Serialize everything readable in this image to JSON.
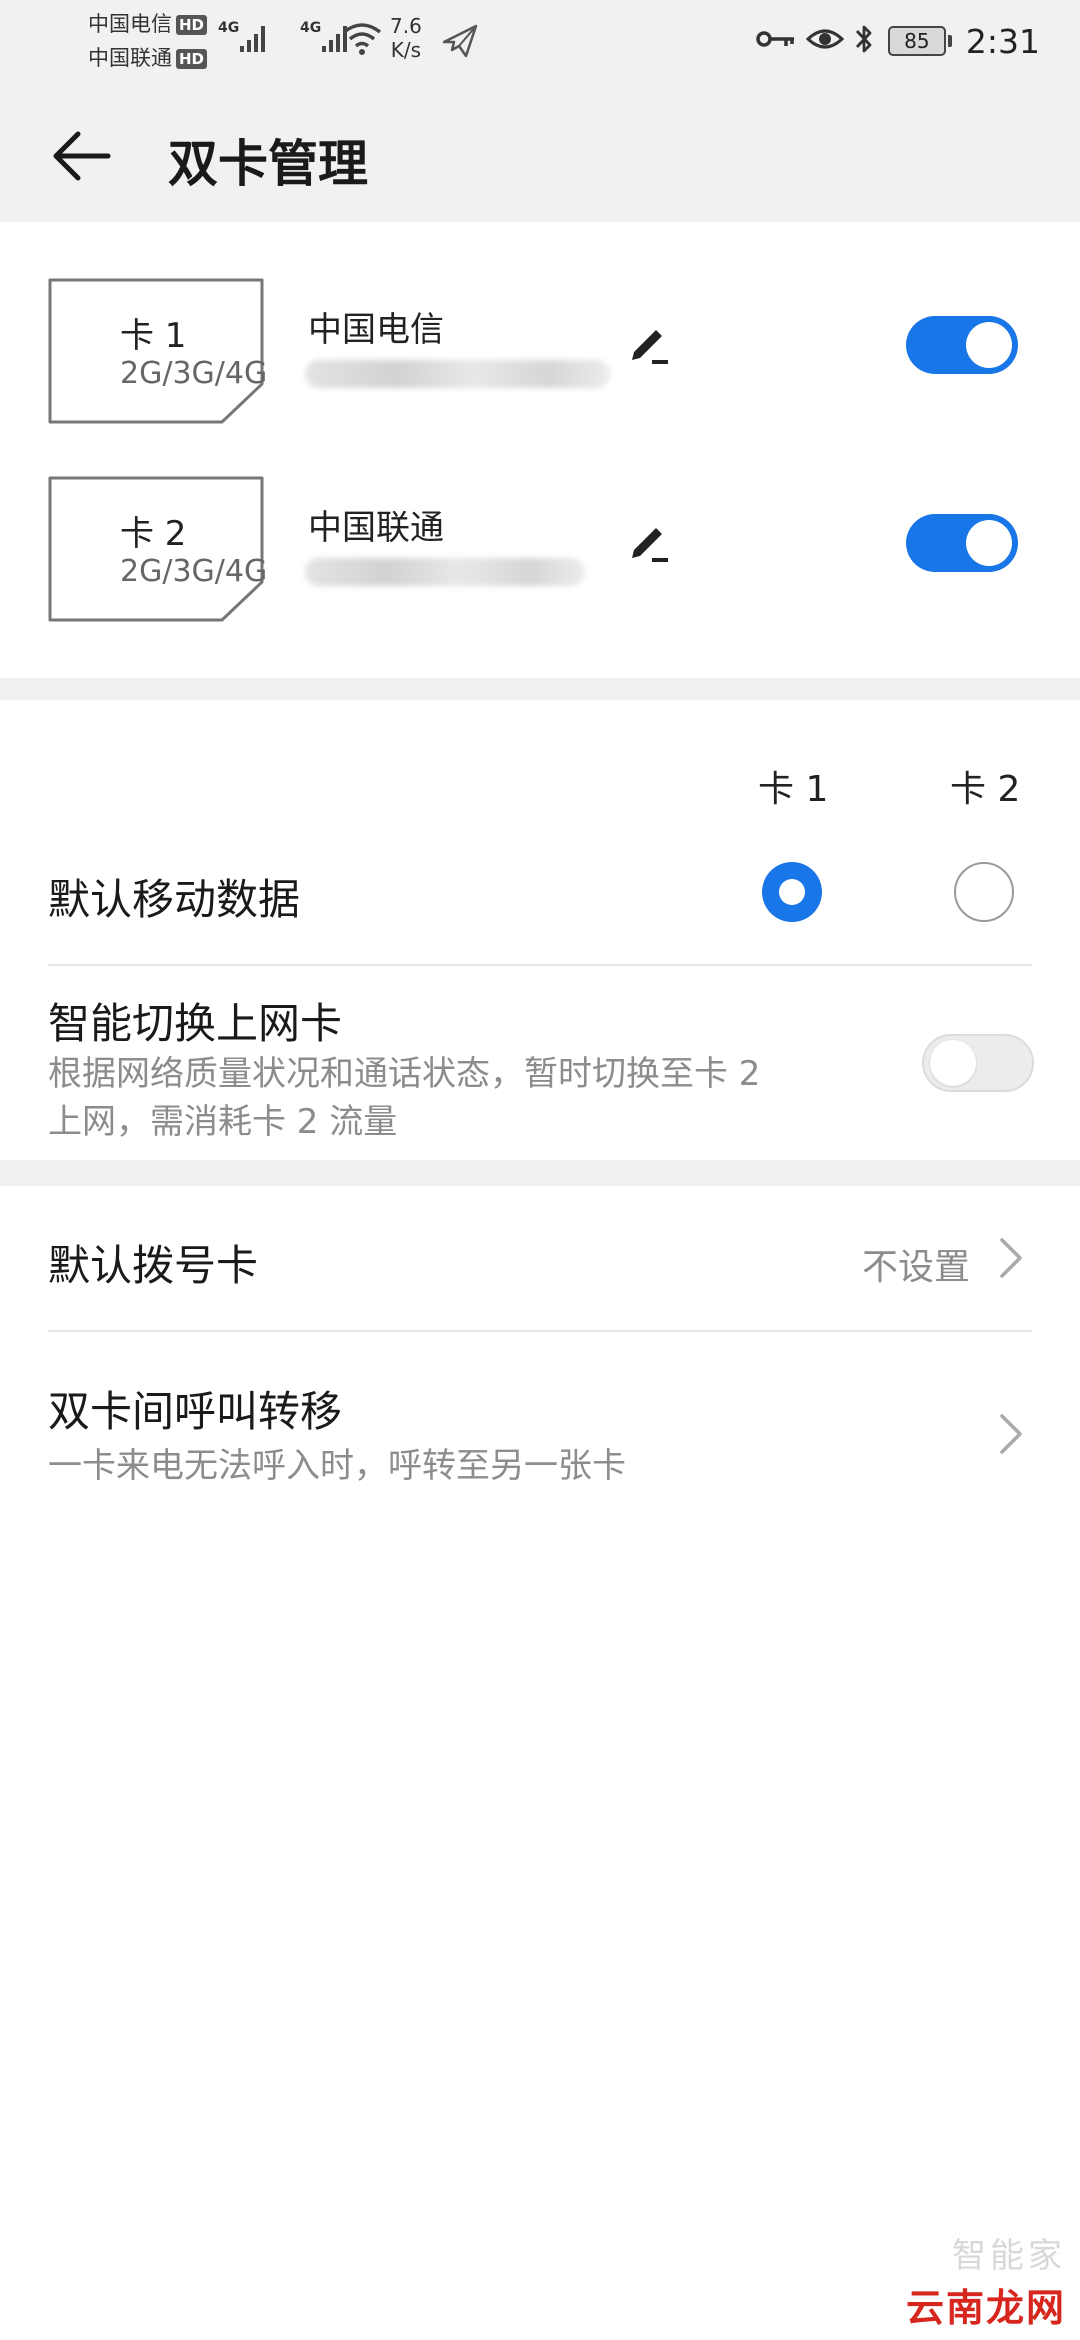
{
  "status_bar": {
    "carrier_1": "中国电信",
    "carrier_2": "中国联通",
    "hd_badge": "HD",
    "network_type_1": "4G",
    "network_type_2": "4G",
    "speed_value": "7.6",
    "speed_unit": "K/s",
    "battery_level": "85",
    "time": "2:31"
  },
  "title_bar": {
    "title": "双卡管理"
  },
  "sims": [
    {
      "label": "卡 1",
      "bands": "2G/3G/4G",
      "carrier": "中国电信",
      "enabled": true
    },
    {
      "label": "卡 2",
      "bands": "2G/3G/4G",
      "carrier": "中国联通",
      "enabled": true
    }
  ],
  "data_settings": {
    "col_card1": "卡 1",
    "col_card2": "卡 2",
    "default_mobile_data": {
      "label": "默认移动数据",
      "selected": "卡 1"
    },
    "smart_switch": {
      "label": "智能切换上网卡",
      "description_line1": "根据网络质量状况和通话状态，暂时切换至卡 2",
      "description_line2": "上网，需消耗卡 2 流量",
      "enabled": false
    }
  },
  "call_settings": {
    "default_dial": {
      "label": "默认拨号卡",
      "value": "不设置"
    },
    "call_forwarding": {
      "label": "双卡间呼叫转移",
      "description": "一卡来电无法呼入时，呼转至另一张卡"
    }
  },
  "watermark": {
    "faint_text": "智能家",
    "brand_text": "云南龙网"
  },
  "colors": {
    "accent": "#1976e8",
    "background": "#f1f1f1",
    "watermark_red": "#d7261e"
  },
  "icons": [
    "back-arrow-icon",
    "key-icon",
    "eye-icon",
    "bluetooth-icon",
    "wifi-icon",
    "signal-icon",
    "airplane-icon",
    "edit-icon",
    "chevron-right-icon"
  ]
}
